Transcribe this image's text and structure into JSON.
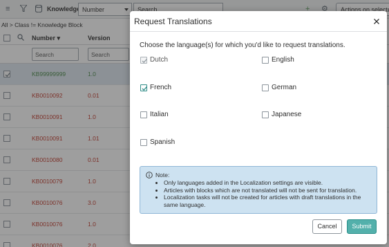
{
  "background": {
    "topbar": {
      "app_title": "Knowledge",
      "field_select": "Number",
      "search_placeholder": "Search",
      "actions_label": "Actions on selected rows"
    },
    "breadcrumb": "All > Class != Knowledge Block",
    "columns": {
      "number": "Number",
      "version": "Version",
      "number_filter_placeholder": "Search",
      "version_filter_placeholder": "Search"
    },
    "rows": [
      {
        "number": "KB99999999",
        "version": "1.0",
        "selected": true
      },
      {
        "number": "KB0010092",
        "version": "0.01"
      },
      {
        "number": "KB0010091",
        "version": "1.0"
      },
      {
        "number": "KB0010091",
        "version": "1.01"
      },
      {
        "number": "KB0010080",
        "version": "0.01"
      },
      {
        "number": "KB0010079",
        "version": "1.0"
      },
      {
        "number": "KB0010076",
        "version": "3.0"
      },
      {
        "number": "KB0010076",
        "version": "1.0"
      },
      {
        "number": "KB0010076",
        "version": "2.0"
      }
    ]
  },
  "modal": {
    "title": "Request Translations",
    "prompt": "Choose the language(s) for which you'd like to request translations.",
    "languages": [
      {
        "label": "Dutch",
        "state": "checked-disabled"
      },
      {
        "label": "English",
        "state": "unchecked"
      },
      {
        "label": "French",
        "state": "checked"
      },
      {
        "label": "German",
        "state": "unchecked"
      },
      {
        "label": "Italian",
        "state": "unchecked"
      },
      {
        "label": "Japanese",
        "state": "unchecked"
      },
      {
        "label": "Spanish",
        "state": "unchecked"
      }
    ],
    "note": {
      "title": "Note:",
      "items": [
        "Only languages added in the Localization settings are visible.",
        "Articles with blocks which are not translated will not be sent for translation.",
        "Localization tasks will not be created for articles with draft translations in the same language."
      ]
    },
    "cancel_label": "Cancel",
    "submit_label": "Submit"
  },
  "colors": {
    "accent": "#53b0ab",
    "note_bg": "#cde2f1",
    "link_red": "#c0392b"
  }
}
